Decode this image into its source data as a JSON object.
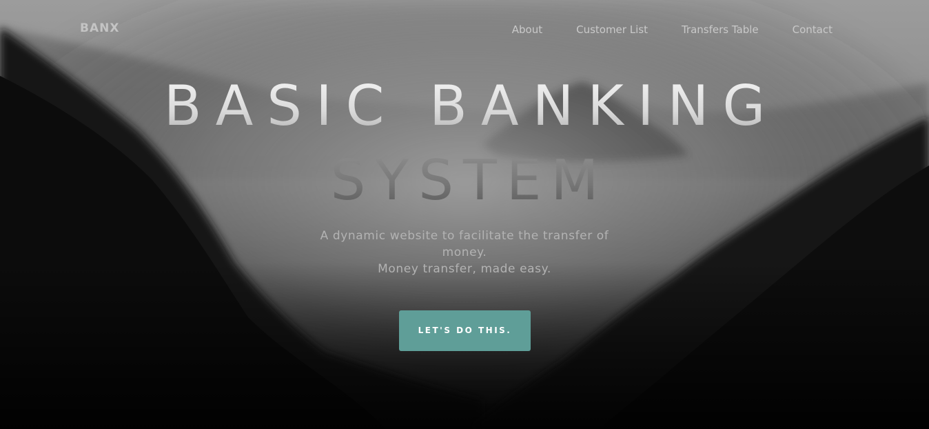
{
  "nav": {
    "brand": "BANX",
    "links": [
      "About",
      "Customer List",
      "Transfers Table",
      "Contact"
    ]
  },
  "hero": {
    "title_line1": "BASIC BANKING",
    "title_line2": "SYSTEM",
    "tagline_line1": "A dynamic website to facilitate the transfer of money.",
    "tagline_line2": "Money transfer, made easy.",
    "cta_label": "LET'S DO THIS."
  },
  "colors": {
    "accent": "#5f9e98",
    "nav_text": "#c9c9c9",
    "tagline_text": "#b3b3b3"
  }
}
